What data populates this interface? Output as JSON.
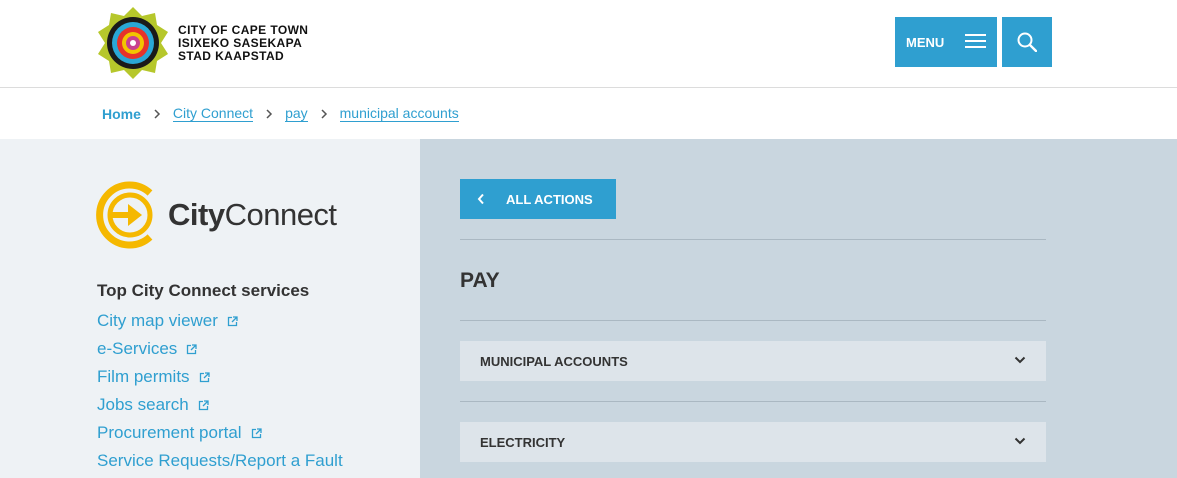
{
  "header": {
    "logo_lines": [
      "CITY OF CAPE TOWN",
      "ISIXEKO SASEKAPA",
      "STAD KAAPSTAD"
    ],
    "menu_label": "MENU",
    "icons": [
      "city-logo-icon",
      "hamburger-icon",
      "search-icon"
    ],
    "accent_color": "#2f9fd0"
  },
  "breadcrumb": {
    "items": [
      "Home",
      "City Connect",
      "pay",
      "municipal accounts"
    ]
  },
  "sidebar": {
    "brand_bold": "City",
    "brand_regular": "Connect",
    "title": "Top City Connect services",
    "items": [
      {
        "label": "City map viewer",
        "external": true
      },
      {
        "label": "e-Services",
        "external": true
      },
      {
        "label": "Film permits",
        "external": true
      },
      {
        "label": "Jobs search",
        "external": true
      },
      {
        "label": "Procurement portal",
        "external": true
      },
      {
        "label": "Service Requests/Report a Fault",
        "external": false
      }
    ]
  },
  "main": {
    "back_label": "ALL ACTIONS",
    "heading": "PAY",
    "accordions": [
      "MUNICIPAL ACCOUNTS",
      "ELECTRICITY"
    ]
  }
}
